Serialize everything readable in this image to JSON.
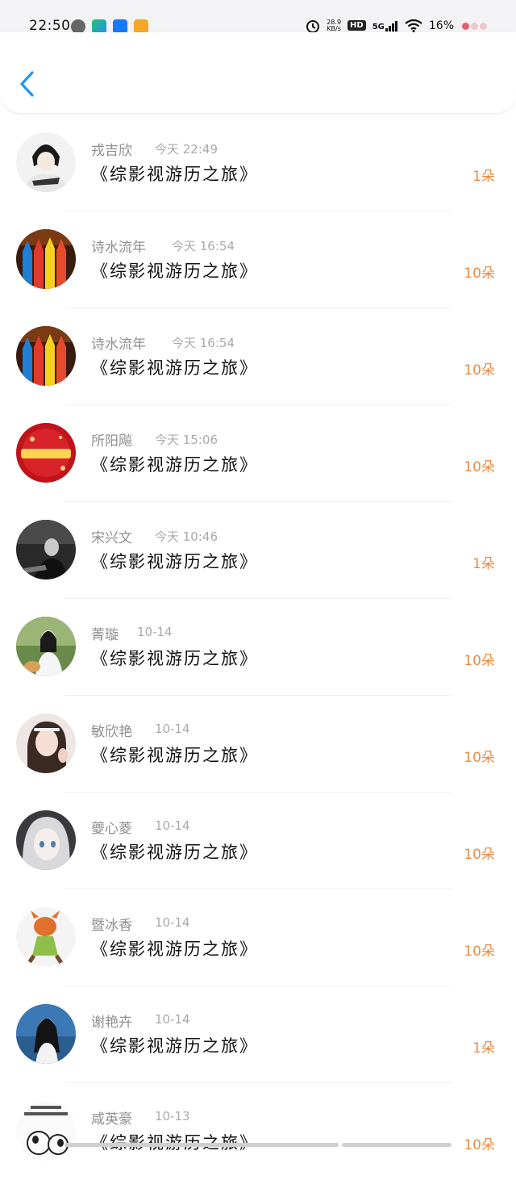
{
  "status_bar": {
    "time": "22:50",
    "network_speed_value": "28.9",
    "network_speed_unit": "KB/s",
    "hd": "HD",
    "net_type": "5G",
    "battery": "16%",
    "app_icons": [
      "wechat-icon",
      "video-app-icon",
      "alipay-icon",
      "notes-app-icon"
    ]
  },
  "header": {
    "back_icon": "chevron-left-icon"
  },
  "rows": [
    {
      "name": "戎吉欣",
      "time": "今天 22:49",
      "title": "《综影视游历之旅》",
      "amount": "1朵"
    },
    {
      "name": "诗水流年",
      "time": "今天 16:54",
      "title": "《综影视游历之旅》",
      "amount": "10朵"
    },
    {
      "name": "诗水流年",
      "time": "今天 16:54",
      "title": "《综影视游历之旅》",
      "amount": "10朵"
    },
    {
      "name": "所阳飚",
      "time": "今天 15:06",
      "title": "《综影视游历之旅》",
      "amount": "10朵"
    },
    {
      "name": "宋兴文",
      "time": "今天 10:46",
      "title": "《综影视游历之旅》",
      "amount": "1朵"
    },
    {
      "name": "菁璇",
      "time": "10-14",
      "title": "《综影视游历之旅》",
      "amount": "10朵"
    },
    {
      "name": "敏欣艳",
      "time": "10-14",
      "title": "《综影视游历之旅》",
      "amount": "10朵"
    },
    {
      "name": "夔心菱",
      "time": "10-14",
      "title": "《综影视游历之旅》",
      "amount": "10朵"
    },
    {
      "name": "暨冰香",
      "time": "10-14",
      "title": "《综影视游历之旅》",
      "amount": "10朵"
    },
    {
      "name": "谢艳卉",
      "time": "10-14",
      "title": "《综影视游历之旅》",
      "amount": "1朵"
    },
    {
      "name": "咸英豪",
      "time": "10-13",
      "title": "《综影视游历之旅》",
      "amount": "10朵"
    }
  ],
  "colors": {
    "accent_amount": "#ea8b45",
    "back_icon": "#2196f3"
  }
}
